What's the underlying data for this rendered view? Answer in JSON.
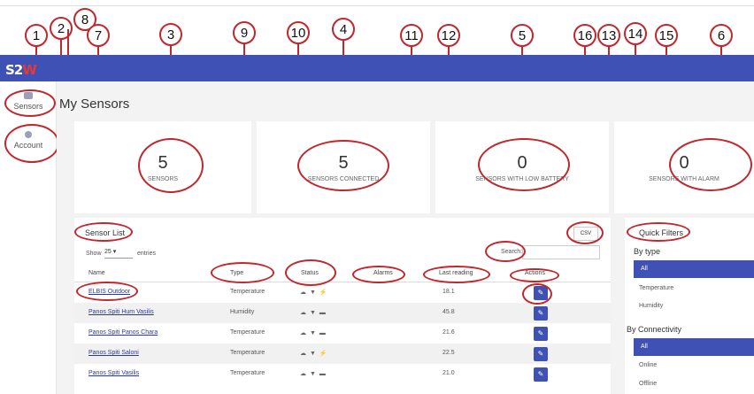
{
  "callouts": [
    "1",
    "2",
    "8",
    "7",
    "3",
    "9",
    "10",
    "4",
    "11",
    "12",
    "5",
    "16",
    "13",
    "14",
    "15",
    "6"
  ],
  "header": {
    "logo_a": "S2",
    "logo_b": "W"
  },
  "sidebar": {
    "items": [
      {
        "label": "Sensors"
      },
      {
        "label": "Account"
      }
    ]
  },
  "page": {
    "title": "My Sensors"
  },
  "cards": [
    {
      "value": "5",
      "label": "SENSORS"
    },
    {
      "value": "5",
      "label": "SENSORS CONNECTED"
    },
    {
      "value": "0",
      "label": "SENSORS WITH LOW BATTERY"
    },
    {
      "value": "0",
      "label": "SENSORS WITH ALARM"
    }
  ],
  "sensor_list": {
    "title": "Sensor List",
    "csv_label": "CSV",
    "show_label": "Show",
    "entries_value": "25",
    "entries_label": "entries",
    "search_label": "Search:",
    "columns": [
      "Name",
      "Type",
      "Status",
      "Alarms",
      "Last reading",
      "Actions"
    ],
    "rows": [
      {
        "name": "ELBIS Outdoor",
        "type": "Temperature",
        "status": "☁ ▼ ⚡",
        "alarms": "",
        "reading": "18.1"
      },
      {
        "name": "Panos Spiti Hum Vasilis",
        "type": "Humidity",
        "status": "☁ ▼ ▬",
        "alarms": "",
        "reading": "45.8"
      },
      {
        "name": "Panos Spiti Panos Chara",
        "type": "Temperature",
        "status": "☁ ▼ ▬",
        "alarms": "",
        "reading": "21.6"
      },
      {
        "name": "Panos Spiti Saloni",
        "type": "Temperature",
        "status": "☁ ▼ ⚡",
        "alarms": "",
        "reading": "22.5"
      },
      {
        "name": "Panos Spiti Vasilis",
        "type": "Temperature",
        "status": "☁ ▼ ▬",
        "alarms": "",
        "reading": "21.0"
      }
    ]
  },
  "quick_filters": {
    "title": "Quick Filters",
    "by_type": {
      "heading": "By type",
      "options": [
        "All",
        "Temperature",
        "Humidity"
      ]
    },
    "by_connectivity": {
      "heading": "By Connectivity",
      "options": [
        "All",
        "Online",
        "Offline"
      ]
    }
  },
  "colors": {
    "primary": "#3f51b5",
    "annotation": "#c0272d"
  }
}
